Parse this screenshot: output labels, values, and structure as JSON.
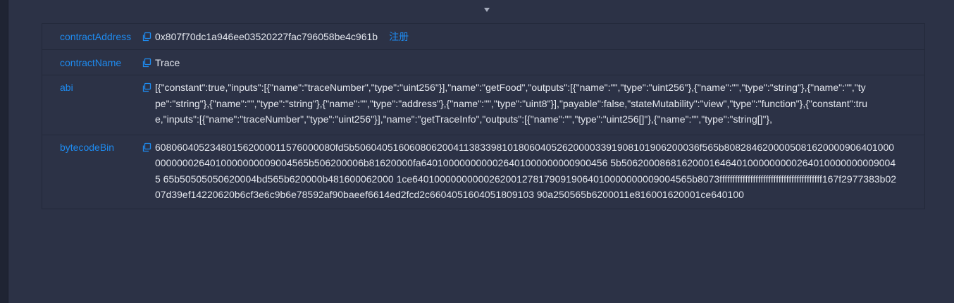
{
  "colors": {
    "background": "#2c3246",
    "key_text": "#1e8bf0",
    "value_text": "#e4e7ee",
    "link": "#1e8bf0",
    "divider": "#23293a"
  },
  "icons": {
    "expand": "caret-down-icon",
    "copy": "copy-icon"
  },
  "contract": {
    "rows": [
      {
        "key": "contractAddress",
        "value": "0x807f70dc1a946ee03520227fac796058be4c961b",
        "action": "注册"
      },
      {
        "key": "contractName",
        "value": "Trace"
      },
      {
        "key": "abi",
        "value": "[{\"constant\":true,\"inputs\":[{\"name\":\"traceNumber\",\"type\":\"uint256\"}],\"name\":\"getFood\",\"outputs\":[{\"name\":\"\",\"type\":\"uint256\"},{\"name\":\"\",\"type\":\"string\"},{\"name\":\"\",\"type\":\"string\"},{\"name\":\"\",\"type\":\"string\"},{\"name\":\"\",\"type\":\"address\"},{\"name\":\"\",\"type\":\"uint8\"}],\"payable\":false,\"stateMutability\":\"view\",\"type\":\"function\"},{\"constant\":true,\"inputs\":[{\"name\":\"traceNumber\",\"type\":\"uint256\"}],\"name\":\"getTraceInfo\",\"outputs\":[{\"name\":\"\",\"type\":\"uint256[]\"},{\"name\":\"\",\"type\":\"string[]\"},"
      },
      {
        "key": "bytecodeBin",
        "value": "608060405234801562000011576000080fd5b506040516060806200411383398101806040526200003391908101906200036f565b80828462000050816200009064010000000000264010000000009004565b506200006b81620000fa6401000000000026401000000000900456 5b506200086816200016464010000000002640100000000090045 65b50505050620004bd565b620000b481600062000 1ce640100000000002620012781790919064010000000009004565b8073ffffffffffffffffffffffffffffffffffffffff167f2977383b0207d39ef14220620b6cf3e6c9b6e78592af90baeef6614ed2fcd2c6604051604051809103 90a250565b6200011e816001620001ce640100"
      }
    ]
  }
}
